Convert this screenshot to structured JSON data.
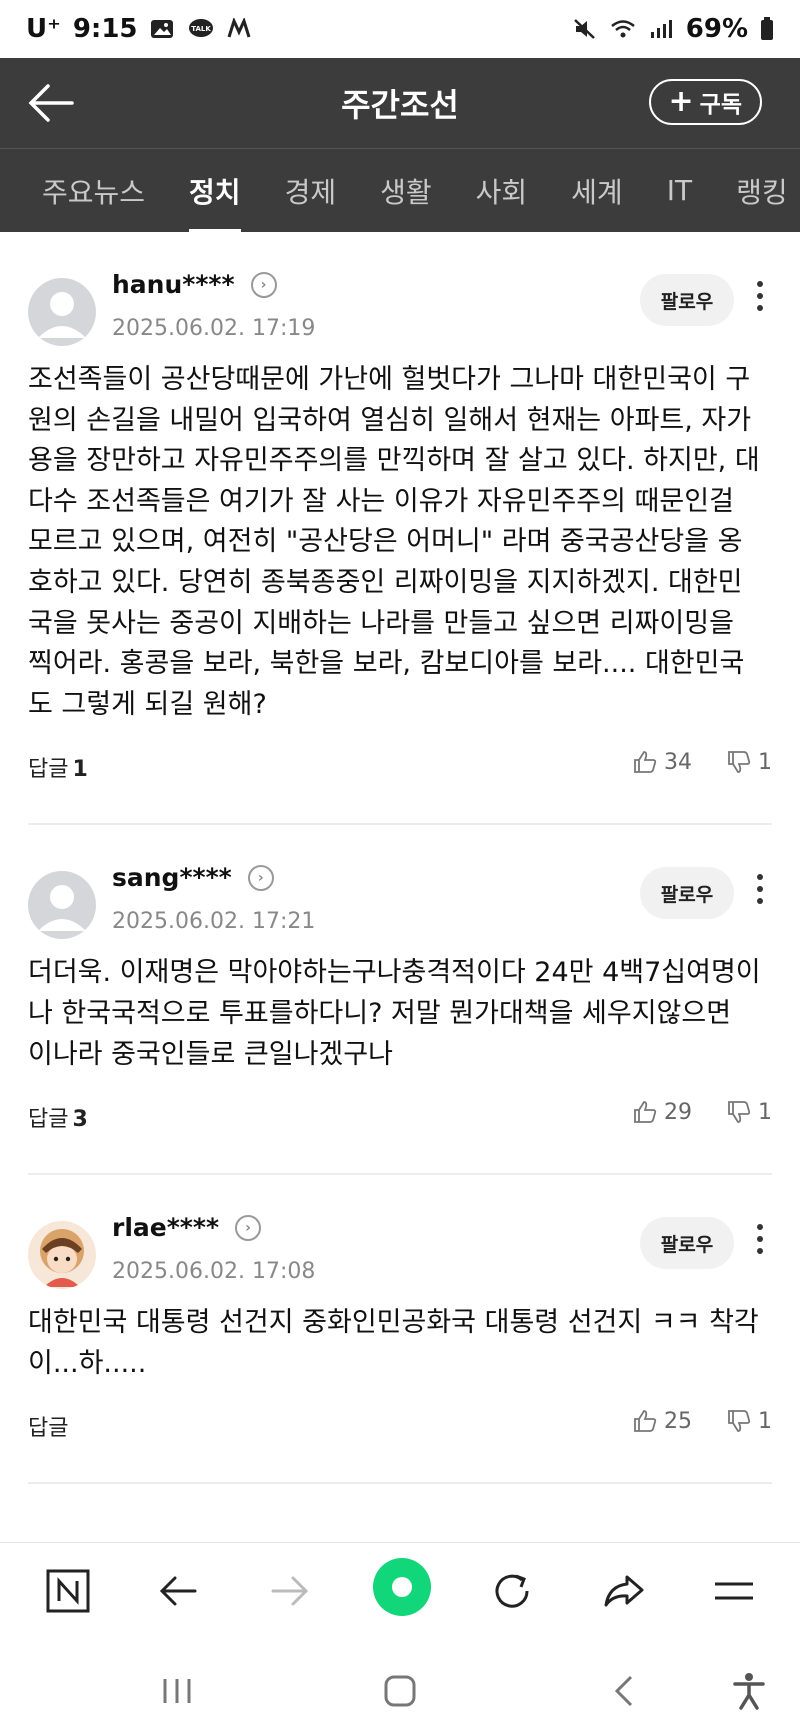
{
  "status_bar": {
    "carrier": "U⁺",
    "time": "9:15",
    "battery": "69%"
  },
  "header": {
    "title": "주간조선",
    "subscribe_label": "구독"
  },
  "tabs": [
    {
      "label": "주요뉴스"
    },
    {
      "label": "정치"
    },
    {
      "label": "경제"
    },
    {
      "label": "생활"
    },
    {
      "label": "사회"
    },
    {
      "label": "세계"
    },
    {
      "label": "IT"
    },
    {
      "label": "랭킹"
    }
  ],
  "comments": [
    {
      "user": "hanu****",
      "date": "2025.06.02. 17:19",
      "follow": "팔로우",
      "body": "조선족들이 공산당때문에 가난에 헐벗다가 그나마 대한민국이 구원의 손길을 내밀어 입국하여 열심히 일해서 현재는 아파트, 자가용을 장만하고 자유민주주의를 만끽하며 잘 살고 있다. 하지만, 대다수 조선족들은 여기가 잘 사는 이유가 자유민주주의 때문인걸 모르고 있으며, 여전히 \"공산당은 어머니\" 라며 중국공산당을 옹호하고 있다. 당연히 종북종중인 리짜이밍을 지지하겠지. 대한민국을 못사는 중공이 지배하는 나라를 만들고 싶으면 리짜이밍을 찍어라. 홍콩을 보라, 북한을 보라, 캄보디아를 보라.... 대한민국도 그렇게 되길 원해?",
      "reply_label": "답글",
      "reply_count": "1",
      "likes": "34",
      "dislikes": "1"
    },
    {
      "user": "sang****",
      "date": "2025.06.02. 17:21",
      "follow": "팔로우",
      "body": "더더욱. 이재명은 막아야하는구나충격적이다 24만 4백7십여명이나 한국국적으로 투표를하다니? 저말 뭔가대책을 세우지않으면 이나라 중국인들로 큰일나겠구나",
      "reply_label": "답글",
      "reply_count": "3",
      "likes": "29",
      "dislikes": "1"
    },
    {
      "user": "rlae****",
      "date": "2025.06.02. 17:08",
      "follow": "팔로우",
      "body": "대한민국 대통령 선건지 중화인민공화국 대통령 선건지 ㅋㅋ 착각이...하.....",
      "reply_label": "답글",
      "reply_count": "",
      "likes": "25",
      "dislikes": "1"
    }
  ],
  "colors": {
    "header_bg": "#3c3c3c",
    "accent_green": "#12d67a"
  }
}
